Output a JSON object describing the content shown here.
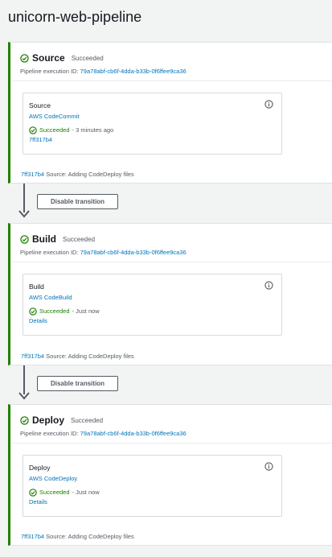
{
  "page": {
    "title": "unicorn-web-pipeline"
  },
  "colors": {
    "success": "#1d8102",
    "link": "#0073bb",
    "muted": "#545b64"
  },
  "stages": [
    {
      "name": "Source",
      "status": "Succeeded",
      "execution_label": "Pipeline execution ID:",
      "execution_id": "79a78abf-cb6f-4dda-b33b-0f6ffee9ca36",
      "action": {
        "name": "Source",
        "provider": "AWS CodeCommit",
        "status": "Succeeded",
        "time": "- 3 minutes ago",
        "link": "7ff317b4",
        "info_icon": "info-icon"
      },
      "commit_id": "7ff317b4",
      "commit_message": "Source: Adding CodeDeploy files"
    },
    {
      "name": "Build",
      "status": "Succeeded",
      "execution_label": "Pipeline execution ID:",
      "execution_id": "79a78abf-cb6f-4dda-b33b-0f6ffee9ca36",
      "action": {
        "name": "Build",
        "provider": "AWS CodeBuild",
        "status": "Succeeded",
        "time": "- Just now",
        "link": "Details",
        "info_icon": "info-icon"
      },
      "commit_id": "7ff317b4",
      "commit_message": "Source: Adding CodeDeploy files"
    },
    {
      "name": "Deploy",
      "status": "Succeeded",
      "execution_label": "Pipeline execution ID:",
      "execution_id": "79a78abf-cb6f-4dda-b33b-0f6ffee9ca36",
      "action": {
        "name": "Deploy",
        "provider": "AWS CodeDeploy",
        "status": "Succeeded",
        "time": "- Just now",
        "link": "Details",
        "info_icon": "info-icon"
      },
      "commit_id": "7ff317b4",
      "commit_message": "Source: Adding CodeDeploy files"
    }
  ],
  "transitions": [
    {
      "button_label": "Disable transition"
    },
    {
      "button_label": "Disable transition"
    }
  ]
}
